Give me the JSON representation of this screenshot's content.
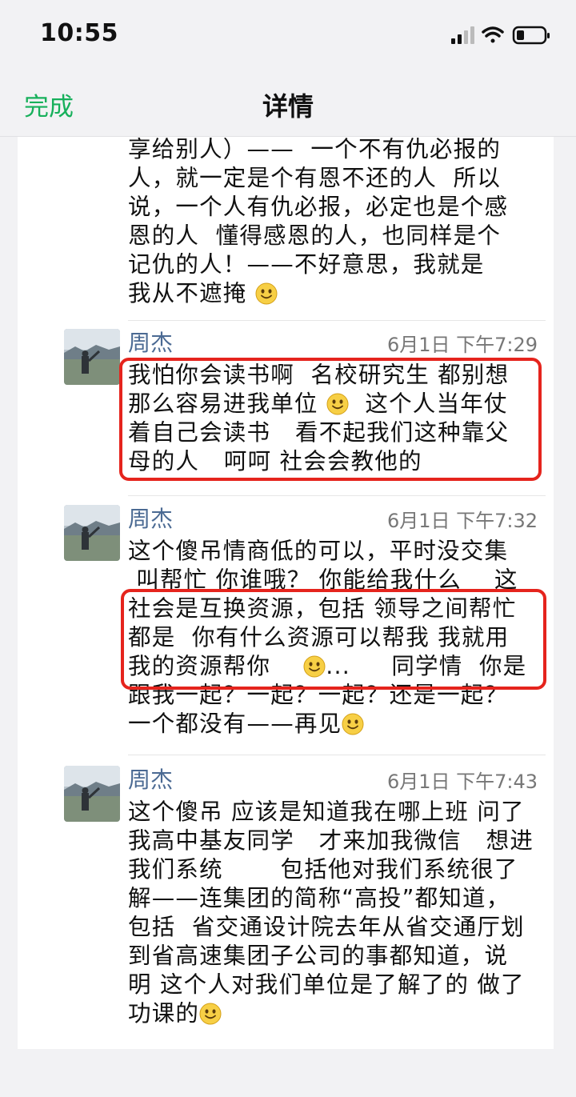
{
  "status": {
    "time": "10:55"
  },
  "nav": {
    "back_label": "完成",
    "title": "详情"
  },
  "top_message": {
    "lines": [
      "享给别人）——  一个不有仇必报的",
      "人，就一定是个有恩不还的人  所以",
      "说，一个人有仇必报，必定也是个感",
      "恩的人  懂得感恩的人，也同样是个",
      "记仇的人！——不好意思，我就是",
      "我从不遮掩 "
    ]
  },
  "messages": [
    {
      "sender": "周杰",
      "time": "6月1日  下午7:29",
      "lines": [
        "我怕你会读书啊  名校研究生 都别想",
        "那么容易进我单位 ",
        "着自己会读书   看不起我们这种靠父",
        "母的人   呵呵 社会会教他的"
      ],
      "line2_tail": "  这个人当年仗"
    },
    {
      "sender": "周杰",
      "time": "6月1日  下午7:32",
      "lines": [
        "这个傻吊情商低的可以，平时没交集",
        " 叫帮忙 你谁哦？ 你能给我什么    这",
        "社会是互换资源，包括 领导之间帮忙",
        "都是  你有什么资源可以帮我 我就用",
        "我的资源帮你    ",
        "跟我一起？一起？一起？还是一起？",
        "一个都没有——再见"
      ],
      "line5_tail": "...     同学情  你是"
    },
    {
      "sender": "周杰",
      "time": "6月1日  下午7:43",
      "lines": [
        "这个傻吊 应该是知道我在哪上班 问了",
        "我高中基友同学   才来加我微信   想进",
        "我们系统       包括他对我们系统很了",
        "解——连集团的简称“高投”都知道，",
        "包括  省交通设计院去年从省交通厅划",
        "到省高速集团子公司的事都知道，说",
        "明 这个人对我们单位是了解了的 做了",
        "功课的"
      ]
    }
  ],
  "colors": {
    "accent": "#17b05b",
    "sender": "#4b6a93",
    "highlight": "#e5241d"
  },
  "icons": [
    "signal-icon",
    "wifi-icon",
    "battery-icon",
    "smile-emoji-icon"
  ]
}
